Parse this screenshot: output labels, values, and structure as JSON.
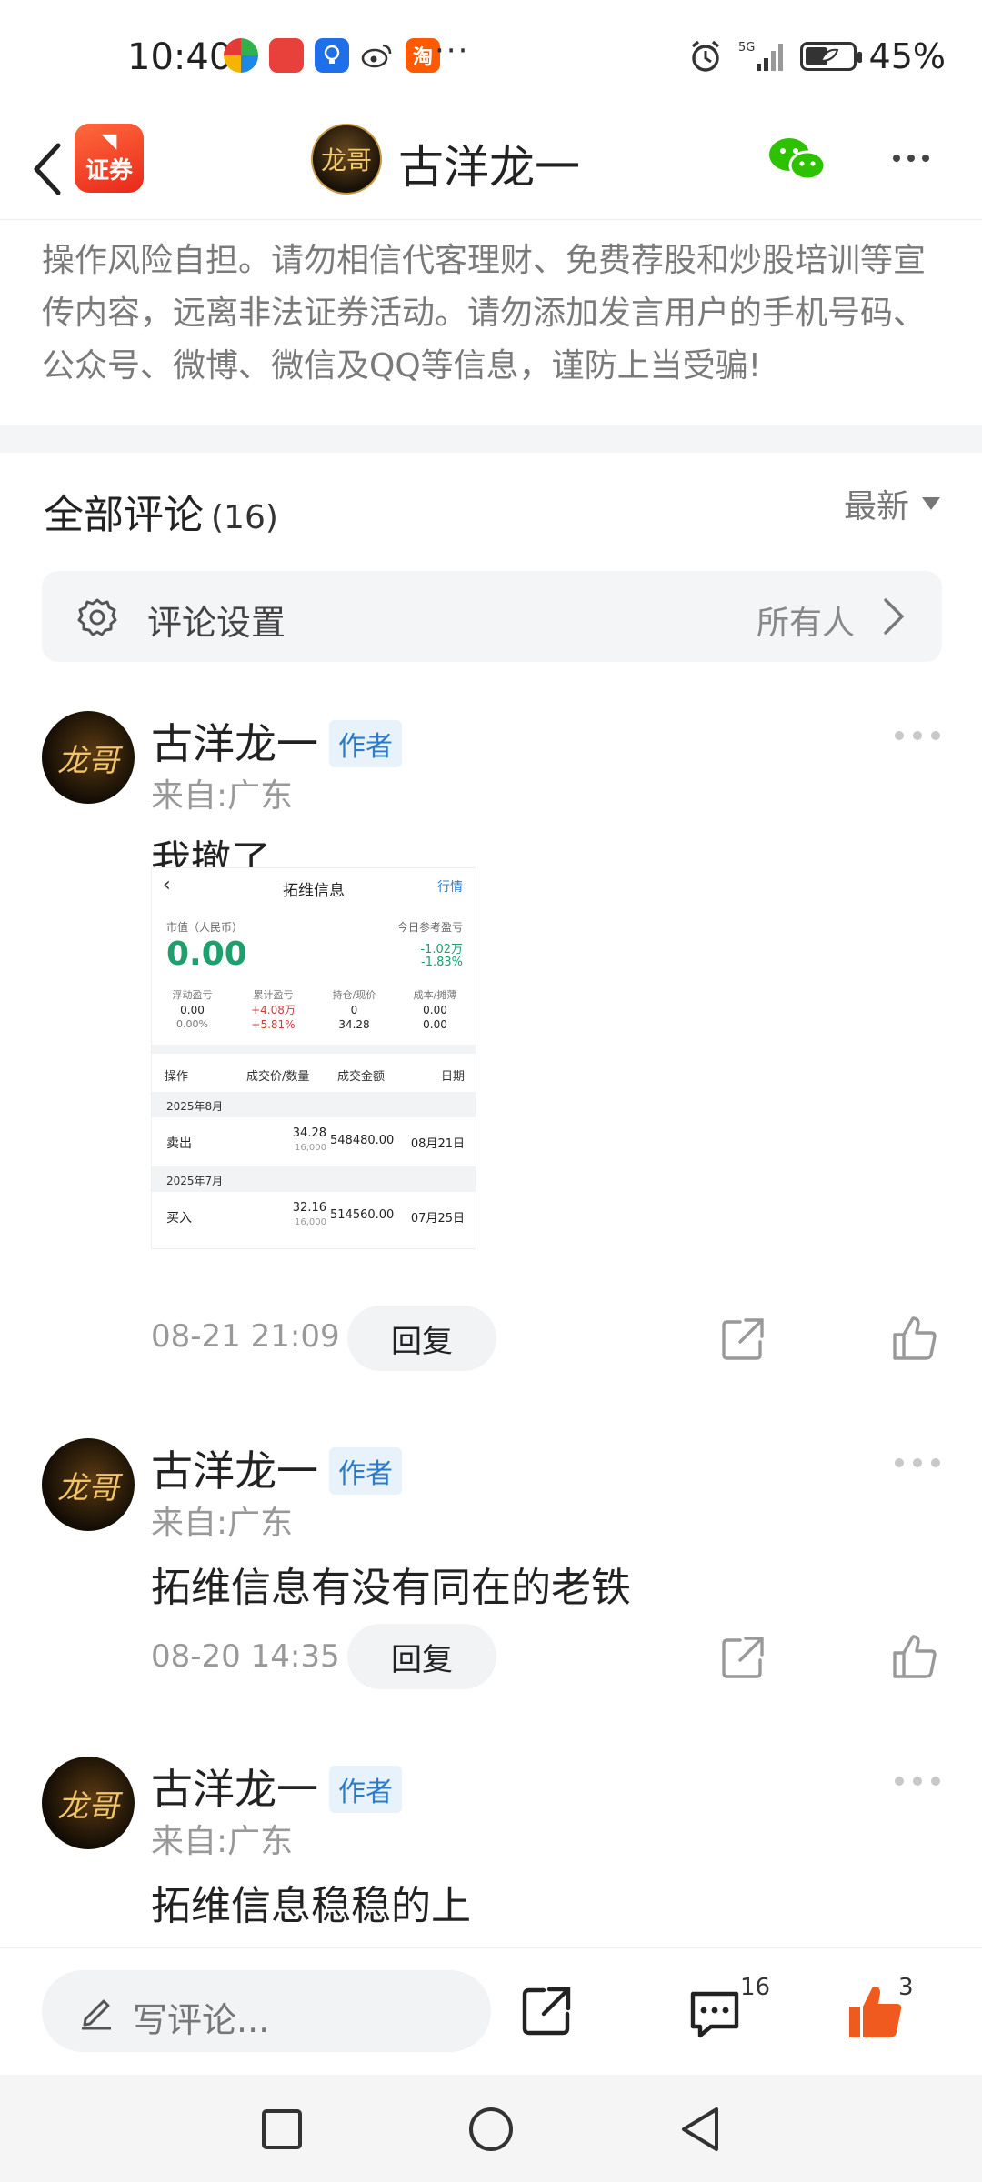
{
  "status_bar": {
    "time": "10:40",
    "battery": "45%",
    "network": "5G",
    "more": "···"
  },
  "header": {
    "logo_text": "证券",
    "title": "古洋龙一",
    "avatar_text": "龙哥"
  },
  "disclaimer": {
    "text": "操作风险自担。请勿相信代客理财、免费荐股和炒股培训等宣传内容，远离非法证券活动。请勿添加发言用户的手机号码、公众号、微博、微信及QQ等信息，谨防上当受骗!"
  },
  "comments_header": {
    "title": "全部评论",
    "count": "(16)",
    "sort_label": "最新"
  },
  "settings": {
    "label": "评论设置",
    "value": "所有人"
  },
  "comments": [
    {
      "author": "古洋龙一",
      "badge": "作者",
      "from": "来自:广东",
      "text": "我撤了",
      "time": "08-21 21:09",
      "reply_label": "回复",
      "screenshot": {
        "back": "‹",
        "title": "拓维信息",
        "link": "行情",
        "market_value_label": "市值（人民币）",
        "market_value": "0.00",
        "ref_label": "今日参考盈亏",
        "ref_value": "-1.02万",
        "ref_percent": "-1.83%",
        "stats": [
          {
            "label": "浮动盈亏",
            "value": "0.00",
            "sub": "0.00%",
            "red": false
          },
          {
            "label": "累计盈亏",
            "value": "+4.08万",
            "sub": "+5.81%",
            "red": true
          },
          {
            "label": "持仓/现价",
            "value": "0",
            "sub": "34.28",
            "red": false
          },
          {
            "label": "成本/摊薄",
            "value": "0.00",
            "sub": "0.00",
            "red": false
          }
        ],
        "table_headers": [
          "操作",
          "成交价/数量",
          "成交金额",
          "日期"
        ],
        "groups": [
          {
            "month": "2025年8月",
            "op": "卖出",
            "price": "34.28",
            "qty": "16,000",
            "amount": "548480.00",
            "date": "08月21日"
          },
          {
            "month": "2025年7月",
            "op": "买入",
            "price": "32.16",
            "qty": "16,000",
            "amount": "514560.00",
            "date": "07月25日"
          }
        ]
      }
    },
    {
      "author": "古洋龙一",
      "badge": "作者",
      "from": "来自:广东",
      "text": "拓维信息有没有同在的老铁",
      "time": "08-20 14:35",
      "reply_label": "回复"
    },
    {
      "author": "古洋龙一",
      "badge": "作者",
      "from": "来自:广东",
      "text": "拓维信息稳稳的上"
    }
  ],
  "bottom_bar": {
    "placeholder": "写评论...",
    "comment_count": "16",
    "like_count": "3"
  },
  "colors": {
    "accent_like": "#f05a1e",
    "badge_blue": "#2c7bc8",
    "profit_green": "#1e9f6e",
    "loss_red": "#d23b3b"
  }
}
